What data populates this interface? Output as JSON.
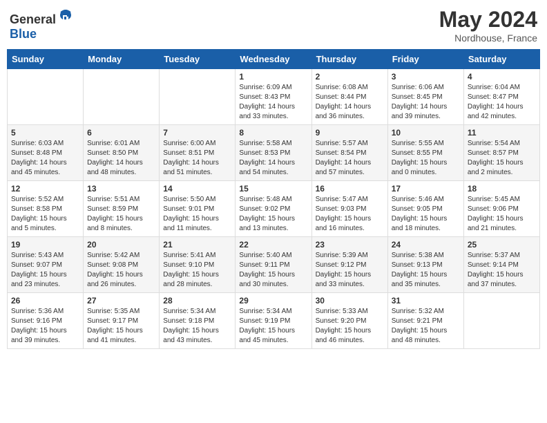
{
  "header": {
    "logo": {
      "general": "General",
      "blue": "Blue"
    },
    "title": "May 2024",
    "location": "Nordhouse, France"
  },
  "calendar": {
    "days_of_week": [
      "Sunday",
      "Monday",
      "Tuesday",
      "Wednesday",
      "Thursday",
      "Friday",
      "Saturday"
    ],
    "weeks": [
      {
        "cells": [
          {
            "day": null,
            "content": ""
          },
          {
            "day": null,
            "content": ""
          },
          {
            "day": null,
            "content": ""
          },
          {
            "day": "1",
            "content": "Sunrise: 6:09 AM\nSunset: 8:43 PM\nDaylight: 14 hours and 33 minutes."
          },
          {
            "day": "2",
            "content": "Sunrise: 6:08 AM\nSunset: 8:44 PM\nDaylight: 14 hours and 36 minutes."
          },
          {
            "day": "3",
            "content": "Sunrise: 6:06 AM\nSunset: 8:45 PM\nDaylight: 14 hours and 39 minutes."
          },
          {
            "day": "4",
            "content": "Sunrise: 6:04 AM\nSunset: 8:47 PM\nDaylight: 14 hours and 42 minutes."
          }
        ]
      },
      {
        "cells": [
          {
            "day": "5",
            "content": "Sunrise: 6:03 AM\nSunset: 8:48 PM\nDaylight: 14 hours and 45 minutes."
          },
          {
            "day": "6",
            "content": "Sunrise: 6:01 AM\nSunset: 8:50 PM\nDaylight: 14 hours and 48 minutes."
          },
          {
            "day": "7",
            "content": "Sunrise: 6:00 AM\nSunset: 8:51 PM\nDaylight: 14 hours and 51 minutes."
          },
          {
            "day": "8",
            "content": "Sunrise: 5:58 AM\nSunset: 8:53 PM\nDaylight: 14 hours and 54 minutes."
          },
          {
            "day": "9",
            "content": "Sunrise: 5:57 AM\nSunset: 8:54 PM\nDaylight: 14 hours and 57 minutes."
          },
          {
            "day": "10",
            "content": "Sunrise: 5:55 AM\nSunset: 8:55 PM\nDaylight: 15 hours and 0 minutes."
          },
          {
            "day": "11",
            "content": "Sunrise: 5:54 AM\nSunset: 8:57 PM\nDaylight: 15 hours and 2 minutes."
          }
        ]
      },
      {
        "cells": [
          {
            "day": "12",
            "content": "Sunrise: 5:52 AM\nSunset: 8:58 PM\nDaylight: 15 hours and 5 minutes."
          },
          {
            "day": "13",
            "content": "Sunrise: 5:51 AM\nSunset: 8:59 PM\nDaylight: 15 hours and 8 minutes."
          },
          {
            "day": "14",
            "content": "Sunrise: 5:50 AM\nSunset: 9:01 PM\nDaylight: 15 hours and 11 minutes."
          },
          {
            "day": "15",
            "content": "Sunrise: 5:48 AM\nSunset: 9:02 PM\nDaylight: 15 hours and 13 minutes."
          },
          {
            "day": "16",
            "content": "Sunrise: 5:47 AM\nSunset: 9:03 PM\nDaylight: 15 hours and 16 minutes."
          },
          {
            "day": "17",
            "content": "Sunrise: 5:46 AM\nSunset: 9:05 PM\nDaylight: 15 hours and 18 minutes."
          },
          {
            "day": "18",
            "content": "Sunrise: 5:45 AM\nSunset: 9:06 PM\nDaylight: 15 hours and 21 minutes."
          }
        ]
      },
      {
        "cells": [
          {
            "day": "19",
            "content": "Sunrise: 5:43 AM\nSunset: 9:07 PM\nDaylight: 15 hours and 23 minutes."
          },
          {
            "day": "20",
            "content": "Sunrise: 5:42 AM\nSunset: 9:08 PM\nDaylight: 15 hours and 26 minutes."
          },
          {
            "day": "21",
            "content": "Sunrise: 5:41 AM\nSunset: 9:10 PM\nDaylight: 15 hours and 28 minutes."
          },
          {
            "day": "22",
            "content": "Sunrise: 5:40 AM\nSunset: 9:11 PM\nDaylight: 15 hours and 30 minutes."
          },
          {
            "day": "23",
            "content": "Sunrise: 5:39 AM\nSunset: 9:12 PM\nDaylight: 15 hours and 33 minutes."
          },
          {
            "day": "24",
            "content": "Sunrise: 5:38 AM\nSunset: 9:13 PM\nDaylight: 15 hours and 35 minutes."
          },
          {
            "day": "25",
            "content": "Sunrise: 5:37 AM\nSunset: 9:14 PM\nDaylight: 15 hours and 37 minutes."
          }
        ]
      },
      {
        "cells": [
          {
            "day": "26",
            "content": "Sunrise: 5:36 AM\nSunset: 9:16 PM\nDaylight: 15 hours and 39 minutes."
          },
          {
            "day": "27",
            "content": "Sunrise: 5:35 AM\nSunset: 9:17 PM\nDaylight: 15 hours and 41 minutes."
          },
          {
            "day": "28",
            "content": "Sunrise: 5:34 AM\nSunset: 9:18 PM\nDaylight: 15 hours and 43 minutes."
          },
          {
            "day": "29",
            "content": "Sunrise: 5:34 AM\nSunset: 9:19 PM\nDaylight: 15 hours and 45 minutes."
          },
          {
            "day": "30",
            "content": "Sunrise: 5:33 AM\nSunset: 9:20 PM\nDaylight: 15 hours and 46 minutes."
          },
          {
            "day": "31",
            "content": "Sunrise: 5:32 AM\nSunset: 9:21 PM\nDaylight: 15 hours and 48 minutes."
          },
          {
            "day": null,
            "content": ""
          }
        ]
      }
    ]
  }
}
